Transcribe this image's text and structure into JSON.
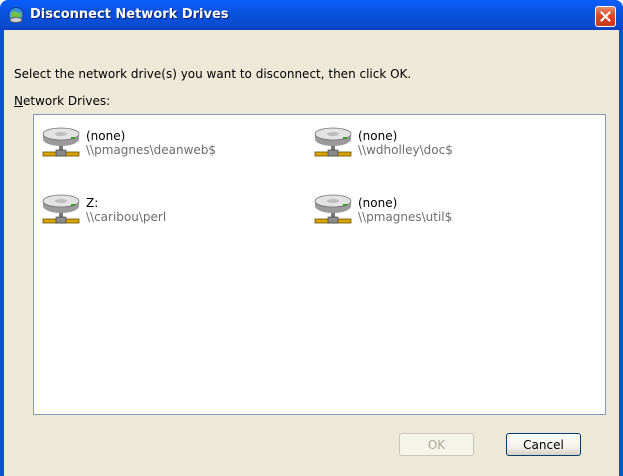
{
  "window": {
    "title": "Disconnect Network Drives",
    "title_icon": "network-drive-icon",
    "close_icon": "close-icon"
  },
  "dialog": {
    "instructions": "Select the network drive(s) you want to disconnect, then click OK.",
    "drives_label": "Network Drives:",
    "drives": [
      {
        "name": "(none)",
        "path": "\\\\pmagnes\\deanweb$",
        "icon": "network-drive-icon"
      },
      {
        "name": "(none)",
        "path": "\\\\wdholley\\doc$",
        "icon": "network-drive-icon"
      },
      {
        "name": "Z:",
        "path": "\\\\caribou\\perl",
        "icon": "network-drive-icon"
      },
      {
        "name": "(none)",
        "path": "\\\\pmagnes\\util$",
        "icon": "network-drive-icon"
      }
    ]
  },
  "buttons": {
    "ok_label": "OK",
    "ok_enabled": false,
    "cancel_label": "Cancel"
  },
  "colors": {
    "titlebar": "#0a4dd4",
    "dialog_bg": "#ece9d8",
    "close_button": "#d94a22"
  }
}
